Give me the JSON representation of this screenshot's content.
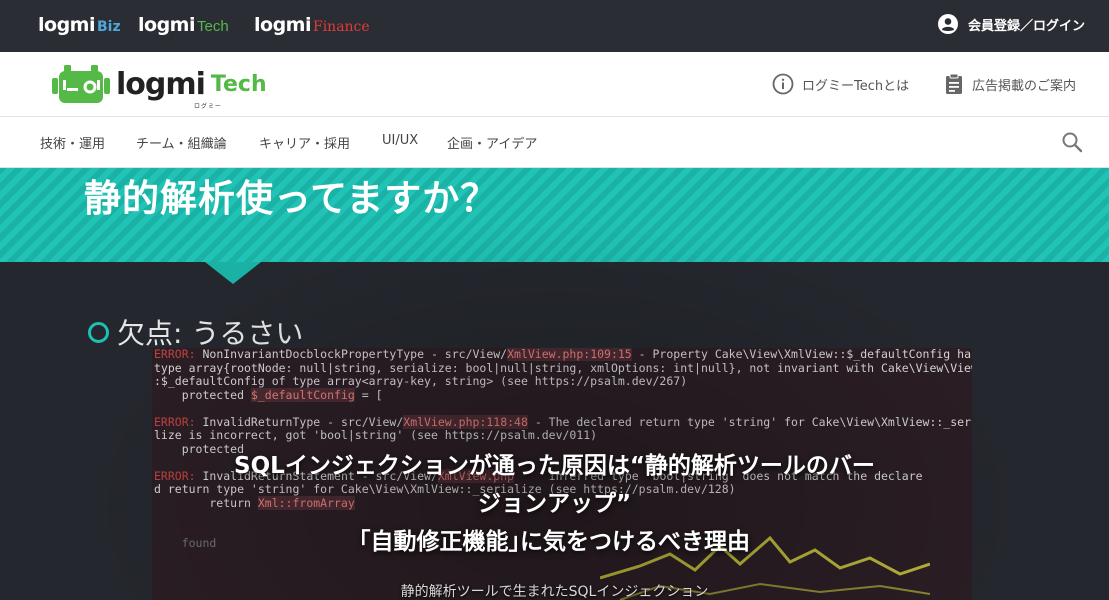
{
  "topbar": {
    "brands": [
      {
        "main": "logmi",
        "sub": "Biz"
      },
      {
        "main": "logmi",
        "sub": "Tech"
      },
      {
        "main": "logmi",
        "sub": "Finance"
      }
    ],
    "login_label": "会員登録／ログイン"
  },
  "header": {
    "logo_word": "logmi",
    "logo_tech": "Tech",
    "logo_kana": "ログミー",
    "about_label": "ログミーTechとは",
    "ads_label": "広告掲載のご案内"
  },
  "nav": {
    "items": [
      "技術・運用",
      "チーム・組織論",
      "キャリア・採用",
      "UI/UX",
      "企画・アイデア"
    ]
  },
  "hero": {
    "slide_title": "静的解析使ってますか？",
    "bullet": "欠点: うるさい",
    "code_lines": [
      {
        "pre": "ERROR: NonInvariantDocblockPropertyType - src/View/",
        "hl": "XmlView.php:109:15",
        "post": " - Property Cake\\View\\XmlView::$_defaultConfig has"
      },
      {
        "pre": "type array{rootNode: null|string, serialize: bool|null|string, xmlOptions: int|null}, not invariant with Cake\\View\\View:",
        "hl": "",
        "post": ""
      },
      {
        "pre": ":$_defaultConfig of type array<array-key, string> (see https://psalm.dev/267)",
        "hl": "",
        "post": ""
      },
      {
        "pre": "    protected ",
        "hl": "$_defaultConfig",
        "post": " = ["
      },
      {
        "pre": "",
        "hl": "",
        "post": ""
      },
      {
        "pre": "ERROR: InvalidReturnType - src/View/",
        "hl": "XmlView.php:118:48",
        "post": " - The declared return type 'string' for Cake\\View\\XmlView::_seria"
      },
      {
        "pre": "lize is incorrect, got 'bool|string' (see https://psalm.dev/011)",
        "hl": "",
        "post": ""
      },
      {
        "pre": "    protected",
        "hl": "",
        "post": ""
      },
      {
        "pre": "",
        "hl": "",
        "post": ""
      },
      {
        "pre": "ERROR: InvalidReturnStatement - src/View/",
        "hl": "XmlView.php",
        "post": "     inferred type 'bool|string' does not match the declare"
      },
      {
        "pre": "d return type 'string' for Cake\\View\\XmlView::_serialize (see https://psalm.dev/128)",
        "hl": "",
        "post": ""
      },
      {
        "pre": "        return ",
        "hl": "Xml::fromArray",
        "post": ""
      },
      {
        "pre": "",
        "hl": "",
        "post": ""
      },
      {
        "pre": "",
        "hl": "",
        "post": ""
      },
      {
        "pre": "    found",
        "hl": "",
        "post": ""
      }
    ],
    "headline_1": "SQLインジェクションが通った原因は“静的解析ツールのバー",
    "headline_2": "ジョンアップ”",
    "headline_3": "｢自動修正機能｣に気をつけるべき理由",
    "caption": "静的解析ツールで生まれたSQLインジェクション"
  },
  "colors": {
    "teal": "#1fbfb3",
    "biz": "#4fa6d8",
    "tech_green": "#55b947",
    "finance_red": "#e23b3b"
  }
}
